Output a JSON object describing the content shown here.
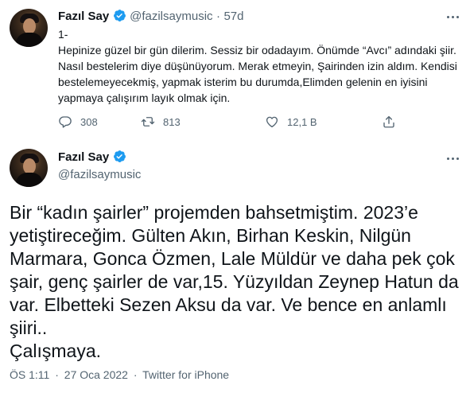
{
  "tweet1": {
    "author_name": "Fazıl Say",
    "handle": "@fazilsaymusic",
    "separator": "·",
    "time": "57d",
    "text": "1-\nHepinize güzel bir gün dilerim. Sessiz bir odadayım. Önümde “Avcı” adındaki şiir. Nasıl bestelerim diye düşünüyorum. Merak etmeyin, Şairinden izin aldım. Kendisi bestelemeyecekmiş, yapmak isterim bu durumda,Elimden gelenin en iyisini yapmaya çalışırım layık olmak için.",
    "replies": "308",
    "retweets": "813",
    "likes": "12,1 B"
  },
  "tweet2": {
    "author_name": "Fazıl Say",
    "handle": "@fazilsaymusic",
    "text": "Bir “kadın şairler” projemden bahsetmiştim. 2023’e yetiştireceğim. Gülten Akın, Birhan Keskin, Nilgün Marmara, Gonca Özmen, Lale Müldür ve daha pek çok şair, genç şairler de var,15. Yüzyıldan Zeynep Hatun da var. Elbetteki Sezen Aksu da var. Ve bence en anlamlı şiiri..\nÇalışmaya.",
    "time": "ÖS 1:11",
    "date": "27 Oca 2022",
    "separator": "·",
    "source": "Twitter for iPhone"
  },
  "colors": {
    "text": "#0f1419",
    "secondary": "#536471",
    "verified": "#1d9bf0"
  },
  "icons": [
    "verified-badge-icon",
    "more-options-icon",
    "reply-icon",
    "retweet-icon",
    "like-icon",
    "share-icon"
  ]
}
